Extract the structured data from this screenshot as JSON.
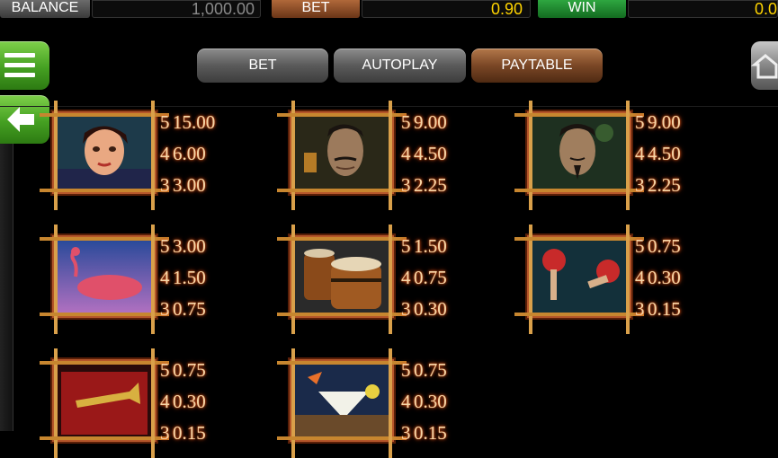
{
  "topbar": {
    "balance_label": "BALANCE",
    "balance_value": "1,000.00",
    "bet_label": "BET",
    "bet_value": "0.90",
    "win_label": "WIN",
    "win_value": "0.0"
  },
  "tabs": [
    {
      "label": "BET",
      "active": false
    },
    {
      "label": "AUTOPLAY",
      "active": false
    },
    {
      "label": "PAYTABLE",
      "active": true
    }
  ],
  "icons": {
    "menu": "hamburger-icon",
    "back": "arrow-left-icon",
    "edge": "home-icon"
  },
  "colors": {
    "background": "#000000",
    "value_yellow": "#ffd400",
    "win_green": "#2ea640",
    "bet_brown": "#8a4a24",
    "menu_green": "#45a022",
    "frame": "#b5562a",
    "pay_text": "#f5d6a8"
  },
  "symbols": [
    {
      "name": "woman",
      "pays": [
        {
          "n": "5",
          "v": "15.00"
        },
        {
          "n": "4",
          "v": "6.00"
        },
        {
          "n": "3",
          "v": "3.00"
        }
      ]
    },
    {
      "name": "man-with-mustache",
      "pays": [
        {
          "n": "5",
          "v": "9.00"
        },
        {
          "n": "4",
          "v": "4.50"
        },
        {
          "n": "3",
          "v": "2.25"
        }
      ]
    },
    {
      "name": "man-with-goatee",
      "pays": [
        {
          "n": "5",
          "v": "9.00"
        },
        {
          "n": "4",
          "v": "4.50"
        },
        {
          "n": "3",
          "v": "2.25"
        }
      ]
    },
    {
      "name": "flamingo",
      "pays": [
        {
          "n": "5",
          "v": "3.00"
        },
        {
          "n": "4",
          "v": "1.50"
        },
        {
          "n": "3",
          "v": "0.75"
        }
      ]
    },
    {
      "name": "bongo-drums",
      "pays": [
        {
          "n": "5",
          "v": "1.50"
        },
        {
          "n": "4",
          "v": "0.75"
        },
        {
          "n": "3",
          "v": "0.30"
        }
      ]
    },
    {
      "name": "maracas",
      "pays": [
        {
          "n": "5",
          "v": "0.75"
        },
        {
          "n": "4",
          "v": "0.30"
        },
        {
          "n": "3",
          "v": "0.15"
        }
      ]
    },
    {
      "name": "trumpet-case",
      "pays": [
        {
          "n": "5",
          "v": "0.75"
        },
        {
          "n": "4",
          "v": "0.30"
        },
        {
          "n": "3",
          "v": "0.15"
        }
      ]
    },
    {
      "name": "cocktail",
      "pays": [
        {
          "n": "5",
          "v": "0.75"
        },
        {
          "n": "4",
          "v": "0.30"
        },
        {
          "n": "3",
          "v": "0.15"
        }
      ]
    }
  ]
}
